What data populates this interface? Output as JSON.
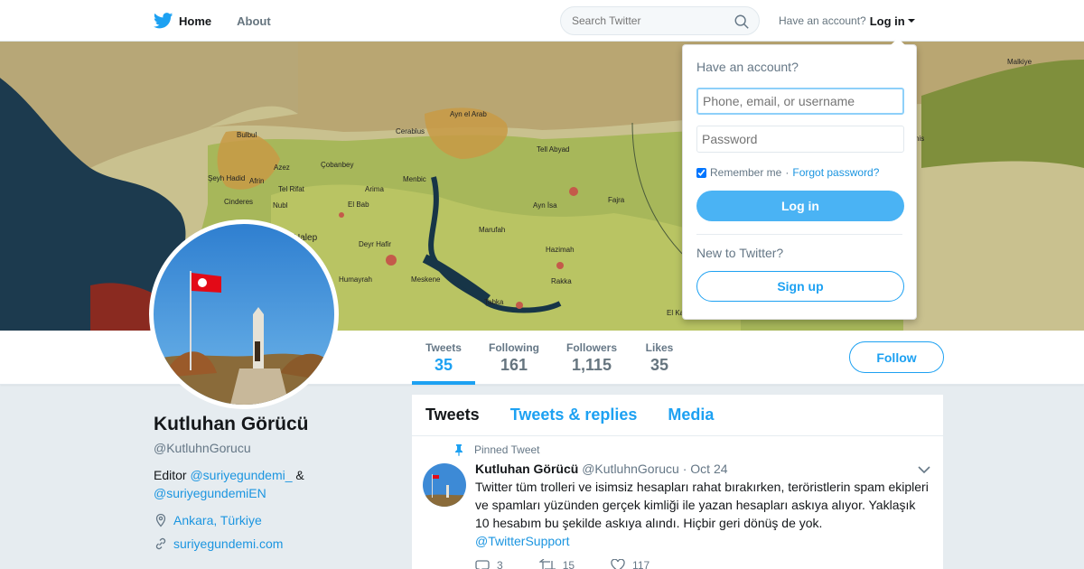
{
  "nav": {
    "home_label": "Home",
    "about_label": "About",
    "search_placeholder": "Search Twitter",
    "account_prompt": "Have an account?",
    "login_label": "Log in"
  },
  "header_map": {
    "labels": [
      "Bulbul",
      "Ayn el Arab",
      "Cerablus",
      "Tell Abyad",
      "Malkiye",
      "Şeyh Hadid",
      "Azez",
      "Çobanbey",
      "Afrin",
      "Tel Rifat",
      "Arima",
      "Menbic",
      "Cinderes",
      "Nubl",
      "El Bab",
      "Ayn İsa",
      "Fajra",
      "Marufah",
      "Deyr Hafir",
      "Hazimah",
      "Humayrah",
      "Meskene",
      "Rakka",
      "Tabka",
      "El Ka",
      "Halep",
      "his"
    ]
  },
  "profile_nav": {
    "stats": [
      {
        "label": "Tweets",
        "value": "35"
      },
      {
        "label": "Following",
        "value": "161"
      },
      {
        "label": "Followers",
        "value": "1,115"
      },
      {
        "label": "Likes",
        "value": "35"
      }
    ],
    "follow_label": "Follow"
  },
  "profile": {
    "name": "Kutluhan Görücü",
    "screen_name": "@KutluhnGorucu",
    "bio_prefix": "Editor",
    "bio_mention_1": "@suriyegundemi_",
    "bio_amp": "&",
    "bio_mention_2": "@suriyegundemiEN",
    "location": "Ankara, Türkiye",
    "website": "suriyegundemi.com"
  },
  "timeline": {
    "tabs": [
      "Tweets",
      "Tweets & replies",
      "Media"
    ],
    "pinned_label": "Pinned Tweet",
    "tweet": {
      "name": "Kutluhan Görücü",
      "handle": "@KutluhnGorucu",
      "separator": "·",
      "time": "Oct 24",
      "text": "Twitter tüm trolleri ve isimsiz hesapları rahat bırakırken, teröristlerin spam ekipleri ve spamları yüzünden gerçek kimliği ile yazan hesapları askıya alıyor. Yaklaşık 10 hesabım bu şekilde askıya alındı. Hiçbir geri dönüş de yok.",
      "mention": "@TwitterSupport",
      "replies": "3",
      "retweets": "15",
      "likes": "117"
    }
  },
  "login_dropdown": {
    "title": "Have an account?",
    "username_placeholder": "Phone, email, or username",
    "password_placeholder": "Password",
    "remember_label": "Remember me",
    "separator": "·",
    "forgot_label": "Forgot password?",
    "login_button": "Log in",
    "new_prompt": "New to Twitter?",
    "signup_button": "Sign up"
  },
  "colors": {
    "accent": "#1da1f2",
    "link": "#1b95e0",
    "background": "#e6ecf0"
  }
}
